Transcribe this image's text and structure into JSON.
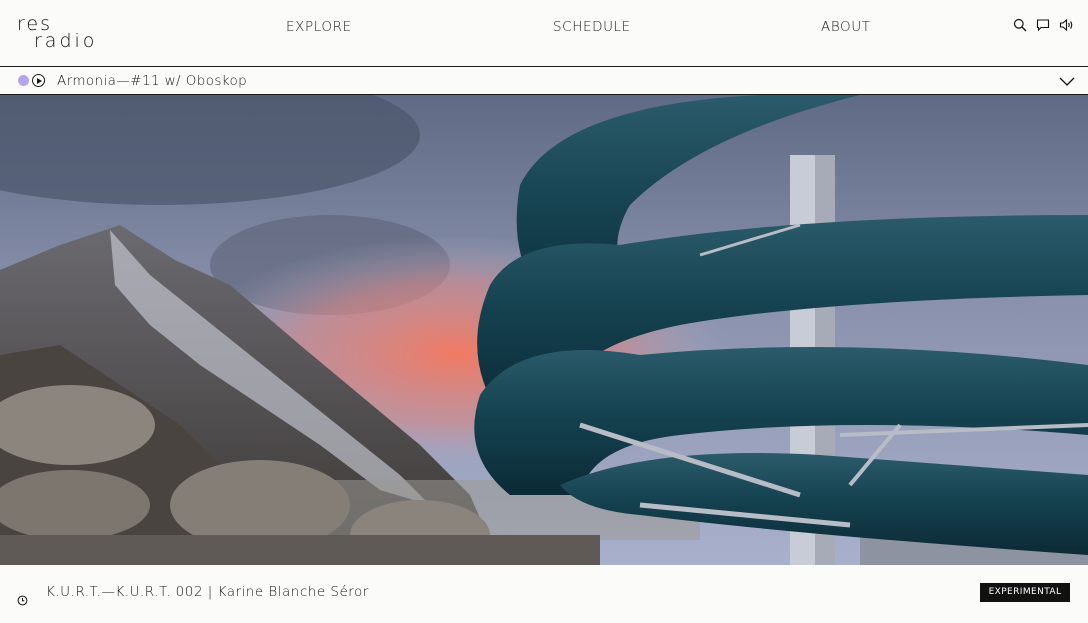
{
  "brand": {
    "line1": "res",
    "line2": "radio"
  },
  "nav": {
    "explore": "EXPLORE",
    "schedule": "SCHEDULE",
    "about": "ABOUT"
  },
  "header_icons": [
    "search-icon",
    "chat-icon",
    "volume-icon"
  ],
  "now_playing": {
    "title": "Armonia—#11 w/ Oboskop",
    "live_color": "#b7a4ee"
  },
  "feature": {
    "title": "K.U.R.T.—K.U.R.T. 002 | Karine Blanche Séror",
    "genre_tag": "EXPERIMENTAL"
  },
  "colors": {
    "ink": "#111111",
    "background": "#fbfbfa",
    "accent": "#b7a4ee"
  }
}
